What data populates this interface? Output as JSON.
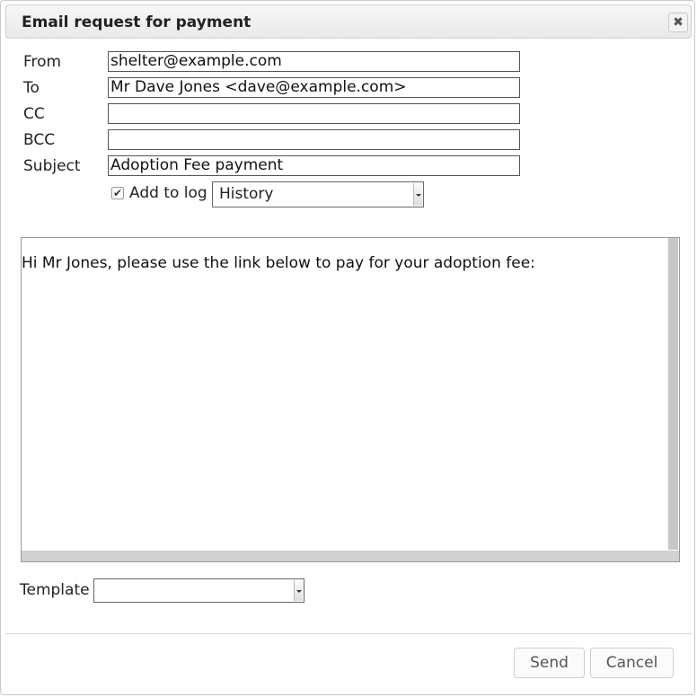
{
  "dialog": {
    "title": "Email request for payment",
    "close_icon": "close-icon"
  },
  "form": {
    "from_label": "From",
    "from_value": "shelter@example.com",
    "to_label": "To",
    "to_value": "Mr Dave Jones <dave@example.com>",
    "cc_label": "CC",
    "cc_value": "",
    "bcc_label": "BCC",
    "bcc_value": "",
    "subject_label": "Subject",
    "subject_value": "Adoption Fee payment",
    "add_to_log_label": "Add to log",
    "add_to_log_checked": true,
    "log_type_selected": "History"
  },
  "editor": {
    "body": "Hi Mr Jones, please use the link below to pay for your adoption fee:"
  },
  "template": {
    "label": "Template",
    "selected": ""
  },
  "buttons": {
    "send": "Send",
    "cancel": "Cancel"
  }
}
